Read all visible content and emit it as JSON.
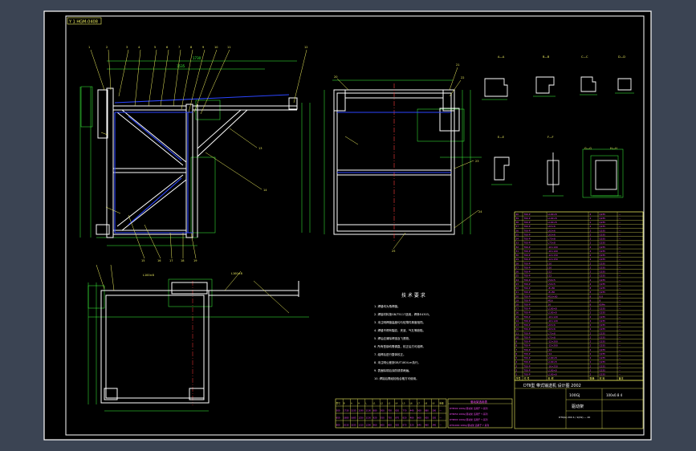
{
  "colors": {
    "background_outer": "#3b4453",
    "sheet": "#000000",
    "frame": "#ffffff",
    "dimension": "#3cff3c",
    "outline": "#ffffff",
    "weld": "#2b45ff",
    "centerline": "#ff3b3b",
    "leader": "#f2f261",
    "table_text": "#ff4dff",
    "table_grid": "#f2f261"
  },
  "sheet": {
    "corner_tag": "Y 1 HGM-0408"
  },
  "views": {
    "front": {
      "name": "front-view",
      "dims_top": [
        "1730",
        "1535"
      ]
    },
    "side": {
      "name": "side-view"
    },
    "plan": {
      "name": "plan-view",
      "label_left": "L100×8",
      "label_right": "L100×8"
    },
    "sections": [
      "A—A",
      "B—B",
      "C—C",
      "D—D",
      "E—E",
      "F—F",
      "G—G",
      "H—H"
    ]
  },
  "notes": {
    "title": "技 术 要 求",
    "lines": [
      "1. 焊缝均为角焊缝。",
      "2. 焊接材料按GB/T5117选用，焊条E4303。",
      "3. 未注明焊缝高度均与较薄件厚度相同。",
      "4. 焊缝不得有裂纹、夹渣、气孔等缺陷。",
      "5. 焊后应清除焊渣及飞溅物。",
      "6. 所有型钢均需调直，校正后方可组焊。",
      "7. 组焊后进行整体校正。",
      "8. 未注明公差按GB/T1804-m执行。",
      "9. 表面除锈后涂防锈漆两遍。",
      "10. 焊接后需经检验合格方可使用。"
    ]
  },
  "title_block": {
    "project": "DTⅡ型 带式输送机 设计图 2002",
    "drawing_no": "100GJ",
    "part_name": "驱动架",
    "scale_row": "100x0.8 4",
    "material_row": "DTⅡ(A) 200 4 / 2(09) — 20"
  },
  "bom_header": [
    "序号",
    "代 号",
    "名 称",
    "数量",
    "材 料",
    "备注"
  ],
  "bom_rows": [
    [
      "40",
      "T00-P",
      "L100×8",
      "2",
      "Q235",
      "—"
    ],
    [
      "39",
      "T00-P",
      "L100×8",
      "2",
      "Q235",
      "—"
    ],
    [
      "38",
      "T00-P",
      "L100×8",
      "2",
      "Q235",
      "—"
    ],
    [
      "37",
      "T00-P",
      "L63×6",
      "2",
      "Q235",
      "—"
    ],
    [
      "36",
      "T00-P",
      "L63×6",
      "2",
      "Q235",
      "—"
    ],
    [
      "35",
      "T00-P",
      "L63×6",
      "2",
      "Q235",
      "—"
    ],
    [
      "34",
      "T00-P",
      "L75×8",
      "2",
      "Q235",
      "—"
    ],
    [
      "33",
      "T00-P",
      "L75×8",
      "2",
      "Q235",
      "—"
    ],
    [
      "32",
      "T00-P",
      "-10×100",
      "4",
      "Q235",
      "—"
    ],
    [
      "31",
      "T00-P",
      "-10×100",
      "4",
      "Q235",
      "—"
    ],
    [
      "30",
      "T00-P",
      "-12×150",
      "4",
      "Q235",
      "—"
    ],
    [
      "29",
      "T00-P",
      "-12×150",
      "4",
      "Q235",
      "—"
    ],
    [
      "28",
      "T00-P",
      "[10",
      "2",
      "Q235",
      "—"
    ],
    [
      "27",
      "T00-P",
      "[10",
      "2",
      "Q235",
      "—"
    ],
    [
      "26",
      "T00-P",
      "[12",
      "2",
      "Q235",
      "—"
    ],
    [
      "25",
      "T00-P",
      "[12",
      "2",
      "Q235",
      "—"
    ],
    [
      "24",
      "T00-P",
      "L50×5",
      "4",
      "Q235",
      "—"
    ],
    [
      "23",
      "T00-P",
      "L50×5",
      "4",
      "Q235",
      "—"
    ],
    [
      "22",
      "T00-P",
      "-8×80",
      "8",
      "Q235",
      "—"
    ],
    [
      "21",
      "T00-P",
      "-8×80",
      "8",
      "Q235",
      "—"
    ],
    [
      "20",
      "T00-P",
      "M16×60",
      "8",
      "8.8",
      "—"
    ],
    [
      "19",
      "T00-P",
      "M16",
      "8",
      "8",
      "—"
    ],
    [
      "18",
      "T00-P",
      "16",
      "8",
      "65Mn",
      "—"
    ],
    [
      "17",
      "T00-P",
      "L100×8",
      "2",
      "Q235",
      "—"
    ],
    [
      "16",
      "T00-P",
      "L100×8",
      "2",
      "Q235",
      "—"
    ],
    [
      "15",
      "T00-P",
      "-10×120",
      "2",
      "Q235",
      "—"
    ],
    [
      "14",
      "T00-P",
      "-10×120",
      "2",
      "Q235",
      "—"
    ],
    [
      "13",
      "T00-P",
      "L63×6",
      "2",
      "Q235",
      "—"
    ],
    [
      "12",
      "T00-P",
      "L63×6",
      "2",
      "Q235",
      "—"
    ],
    [
      "11",
      "T00-P",
      "L75×8",
      "2",
      "Q235",
      "—"
    ],
    [
      "10",
      "T00-P",
      "L75×8",
      "2",
      "Q235",
      "—"
    ],
    [
      "9",
      "T00-P",
      "-12×200",
      "2",
      "Q235",
      "—"
    ],
    [
      "8",
      "T00-P",
      "-12×200",
      "2",
      "Q235",
      "—"
    ],
    [
      "7",
      "T00-P",
      "[14",
      "2",
      "Q235",
      "—"
    ],
    [
      "6",
      "T00-P",
      "[14",
      "2",
      "Q235",
      "—"
    ],
    [
      "5",
      "T00-P",
      "L100×8",
      "2",
      "Q235",
      "—"
    ],
    [
      "4",
      "T00-P",
      "L100×8",
      "2",
      "Q235",
      "—"
    ],
    [
      "3",
      "T00-P",
      "-16×250",
      "2",
      "Q235",
      "—"
    ],
    [
      "2",
      "T00-P",
      "L100×8",
      "2",
      "Q235",
      "—"
    ],
    [
      "1",
      "T00-P",
      "L100×8",
      "2",
      "Q235",
      "—"
    ]
  ],
  "size_table": {
    "header": [
      "型号",
      "B",
      "A",
      "H",
      "L",
      "L1",
      "L2",
      "L3",
      "L4",
      "L5",
      "L6",
      "L7",
      "L8",
      "L9",
      "重量"
    ],
    "rows": [
      [
        "500",
        "1730",
        "1535",
        "1190",
        "1100",
        "880",
        "500",
        "700",
        "820",
        "770",
        "440",
        "560",
        "880",
        "300",
        "—"
      ],
      [
        "650",
        "1880",
        "1685",
        "1250",
        "1150",
        "920",
        "550",
        "750",
        "870",
        "820",
        "480",
        "600",
        "920",
        "320",
        "—"
      ],
      [
        "800",
        "2030",
        "1835",
        "1310",
        "1200",
        "960",
        "600",
        "800",
        "920",
        "870",
        "520",
        "640",
        "960",
        "340",
        "—"
      ]
    ]
  },
  "middle_box": {
    "title": "驱动架选用表",
    "lines": [
      "DTⅡ500 100GJ 驱动架 适用于 Y 系列",
      "DTⅡ650 100GJ 驱动架 适用于 Y 系列",
      "DTⅡ800 100GJ 驱动架 适用于 Y 系列",
      "DTⅡ1000 100GJ 驱动架 适用于 Y 系列"
    ]
  }
}
